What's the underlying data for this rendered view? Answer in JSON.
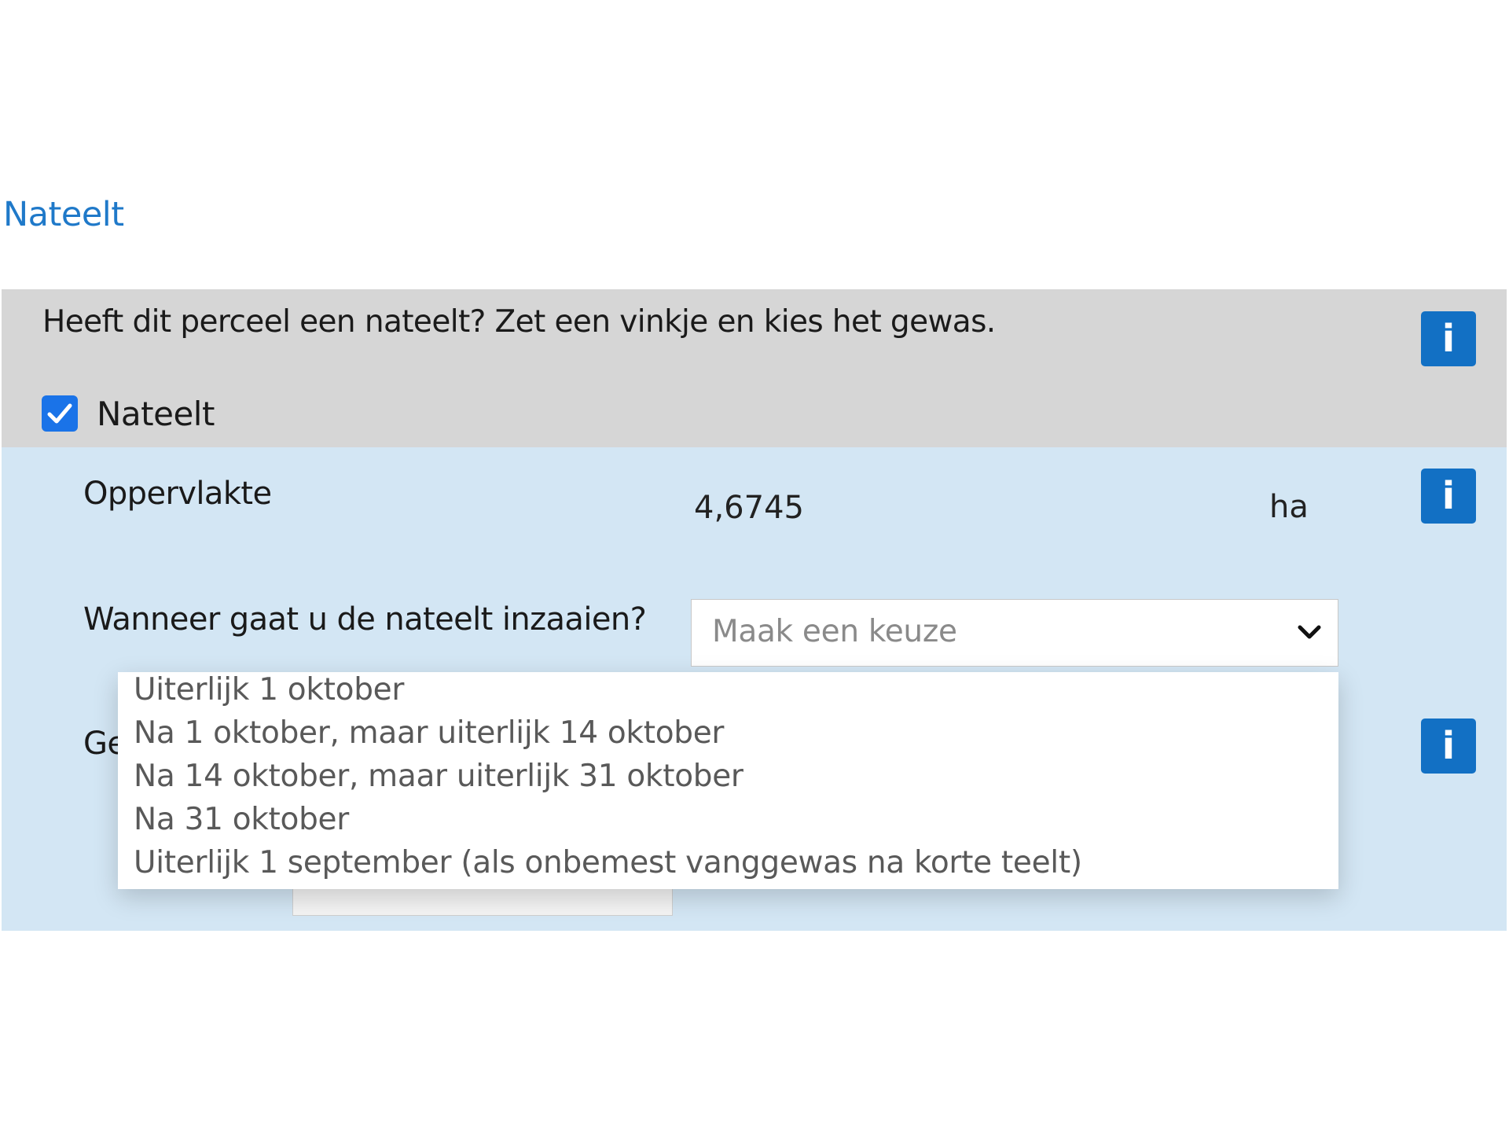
{
  "section_title": "Nateelt",
  "question": "Heeft dit perceel een nateelt? Zet een vinkje en kies het gewas.",
  "nateelt_checkbox": {
    "label": "Nateelt",
    "checked": true
  },
  "info_icon": {
    "glyph": "i",
    "color": "#1270c4"
  },
  "area": {
    "label": "Oppervlakte",
    "value": "4,6745",
    "unit": "ha"
  },
  "sowing": {
    "label": "Wanneer gaat u de nateelt inzaaien?",
    "placeholder": "Maak een keuze",
    "options": [
      "Uiterlijk 1 oktober",
      "Na 1 oktober, maar uiterlijk 14 oktober",
      "Na 14 oktober, maar uiterlijk 31 oktober",
      "Na 31 oktober",
      "Uiterlijk 1 september (als onbemest vanggewas na korte teelt)"
    ]
  },
  "occluded_field_label": "Ge",
  "colors": {
    "accent": "#1f79c9",
    "panel_grey": "#d6d6d6",
    "panel_blue": "#d3e6f4",
    "checkbox": "#1a73e8"
  }
}
